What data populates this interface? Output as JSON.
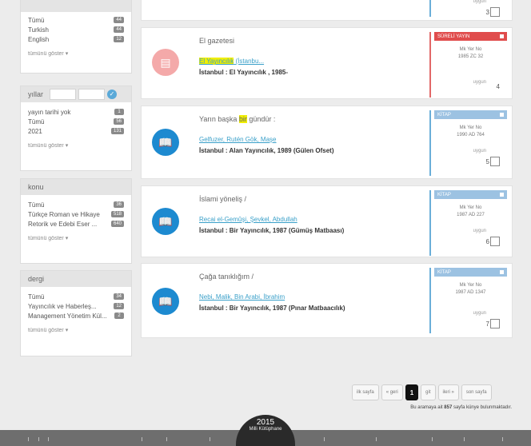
{
  "sidebar": {
    "lang_facet": {
      "items": [
        {
          "label": "Tümü",
          "count": "44"
        },
        {
          "label": "Turkish",
          "count": "44"
        },
        {
          "label": "English",
          "count": "12"
        }
      ],
      "more": "tümünü göster  ▾"
    },
    "years_facet": {
      "title": "yıllar",
      "items": [
        {
          "label": "yayın tarihi yok",
          "count": "1"
        },
        {
          "label": "Tümü",
          "count": "56"
        },
        {
          "label": "2021",
          "count": "131"
        }
      ],
      "more": "tümünü göster  ▾",
      "ok_icon": "✓"
    },
    "subject_facet": {
      "title": "konu",
      "items": [
        {
          "label": "Tümü",
          "count": "36"
        },
        {
          "label": "Türkçe Roman ve Hikaye",
          "count": "518"
        },
        {
          "label": "Retorik ve Edebi Eser ...",
          "count": "640"
        }
      ],
      "more": "tümünü göster  ▾"
    },
    "journal_facet": {
      "title": "dergi",
      "items": [
        {
          "label": "Tümü",
          "count": "34"
        },
        {
          "label": "Yayıncılık ve Haberleş...",
          "count": "12"
        },
        {
          "label": "Management Yönetim Kül...",
          "count": "2"
        }
      ],
      "more": "tümünü göster  ▾"
    }
  },
  "results": [
    {
      "number": "3"
    },
    {
      "title": "El gazetesi",
      "author_hl": "El Yayıncılık",
      "author_rest": " (İstanbu...",
      "publisher": "İstanbul : El Yayıncılık , 1985-",
      "badge": "SÜRELİ YAYIN",
      "shelf_label": "Mk Yer No",
      "shelf_no": "1985 ZC 32",
      "status": "uygun",
      "number": "4"
    },
    {
      "title_pre": "Yarın başka ",
      "title_hl": "bir",
      "title_post": " gündür :",
      "author": "Gelfuzer, Rutén Gök, Maşe",
      "publisher": "İstanbul : Alan Yayıncılık, 1989 (Gülen Ofset)",
      "badge": "KİTAP",
      "shelf_label": "Mk Yer No",
      "shelf_no": "1990 AD 764",
      "status": "uygun",
      "number": "5"
    },
    {
      "title": "İslami yöneliş /",
      "author": "Recai el-Gemûşi, Şevkel, Abdullah",
      "publisher": "İstanbul : Bir Yayıncılık, 1987 (Gümüş Matbaası)",
      "badge": "KİTAP",
      "shelf_label": "Mk Yer No",
      "shelf_no": "1987 AD 227",
      "status": "uygun",
      "number": "6"
    },
    {
      "title": "Çağa tanıklığım /",
      "author": "Nebi, Malik, Bin Arabi, İbrahim",
      "publisher": "İstanbul : Bir Yayıncılık, 1987 (Pınar Matbaacılık)",
      "badge": "KİTAP",
      "shelf_label": "Mk Yer No",
      "shelf_no": "1987 AD 1347",
      "status": "uygun",
      "number": "7"
    }
  ],
  "pagination": {
    "first": "ilk sayfa",
    "prev": "« geri",
    "current": "1",
    "go": "git",
    "next": "ileri »",
    "last": "son sayfa",
    "info_pre": "Bu aramaya ait ",
    "info_count": "857",
    "info_post": " sayfa künye bulunmaktadır."
  },
  "footer": {
    "year": "2015",
    "text": "Milli Kütüphane"
  },
  "colors": {
    "accent_blue": "#1d8ad0",
    "serial_red": "#e04c4c",
    "highlight": "#f0ee00"
  }
}
